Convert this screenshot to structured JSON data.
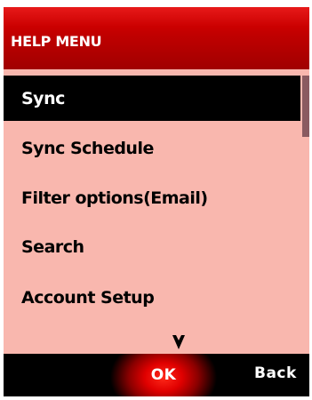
{
  "header": {
    "title": "HELP MENU"
  },
  "menu": {
    "items": [
      {
        "label": "Sync",
        "selected": true
      },
      {
        "label": "Sync Schedule",
        "selected": false
      },
      {
        "label": "Filter options(Email)",
        "selected": false
      },
      {
        "label": "Search",
        "selected": false
      },
      {
        "label": "Account Setup",
        "selected": false
      }
    ],
    "more_indicator_icon": "down-arrow-icon"
  },
  "softkeys": {
    "center_label": "OK",
    "right_label": "Back"
  },
  "colors": {
    "title_bar": "#c00000",
    "list_background": "#f9b7ae",
    "selection": "#000000",
    "scroll_thumb": "#8a5a60",
    "softkey_bar": "#000000"
  }
}
